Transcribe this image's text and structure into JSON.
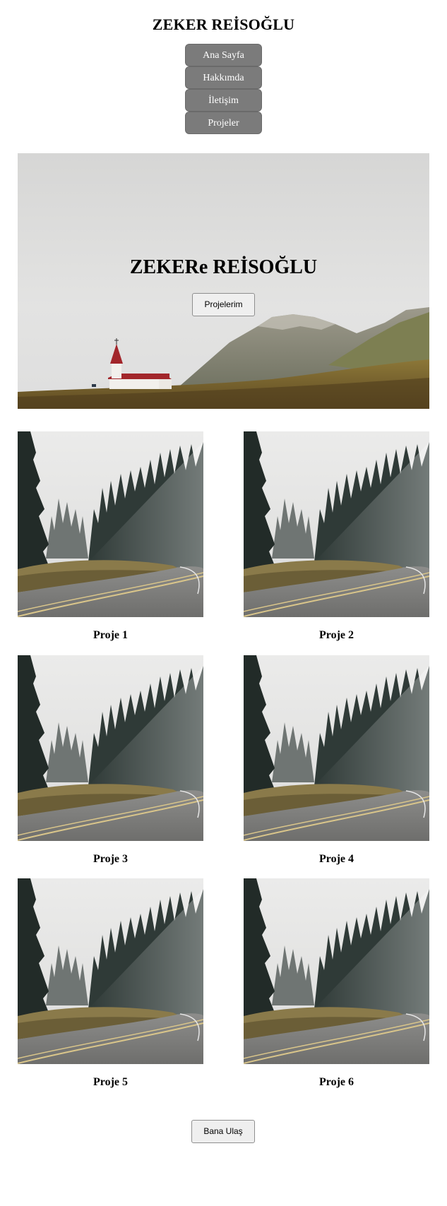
{
  "header": {
    "site_title": "ZEKER REİSOĞLU"
  },
  "nav": {
    "items": [
      {
        "label": "Ana Sayfa"
      },
      {
        "label": "Hakkımda"
      },
      {
        "label": "İletişim"
      },
      {
        "label": "Projeler"
      }
    ],
    "button_color": "#7b7b7b"
  },
  "hero": {
    "title": "ZEKERe REİSOĞLU",
    "button_label": "Projelerim",
    "image": "church-and-mountains-photo"
  },
  "projects": {
    "items": [
      {
        "label": "Proje 1",
        "image": "forest-road-photo"
      },
      {
        "label": "Proje 2",
        "image": "forest-road-photo"
      },
      {
        "label": "Proje 3",
        "image": "forest-road-photo"
      },
      {
        "label": "Proje 4",
        "image": "forest-road-photo"
      },
      {
        "label": "Proje 5",
        "image": "forest-road-photo"
      },
      {
        "label": "Proje 6",
        "image": "forest-road-photo"
      }
    ]
  },
  "footer": {
    "contact_button_label": "Bana Ulaş"
  }
}
